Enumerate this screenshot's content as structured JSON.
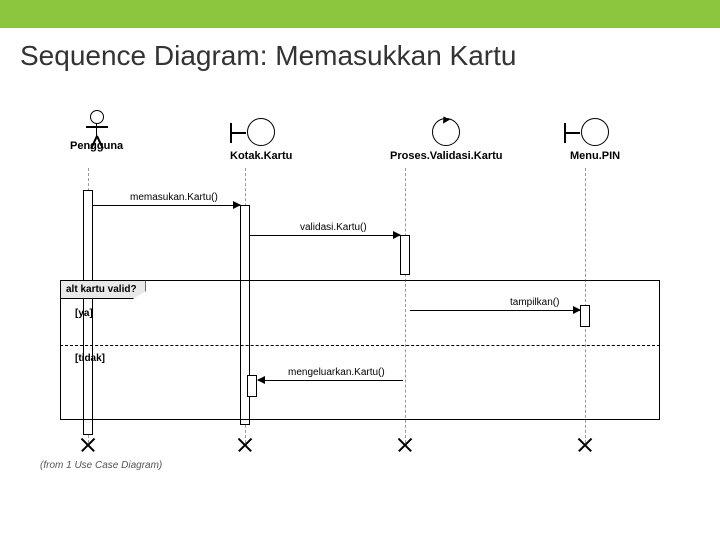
{
  "title": "Sequence Diagram: Memasukkan Kartu",
  "lifelines": {
    "pengguna": "Pengguna",
    "kotakKartu": "Kotak.Kartu",
    "prosesValidasi": "Proses.Validasi.Kartu",
    "menuPIN": "Menu.PIN"
  },
  "messages": {
    "m1": "memasukan.Kartu()",
    "m2": "validasi.Kartu()",
    "m3": "tampilkan()",
    "m4": "mengeluarkan.Kartu()"
  },
  "alt": {
    "label": "alt kartu valid?",
    "guardYa": "[ya]",
    "guardTidak": "[tidak]"
  },
  "footer": "(from 1 Use Case Diagram)"
}
